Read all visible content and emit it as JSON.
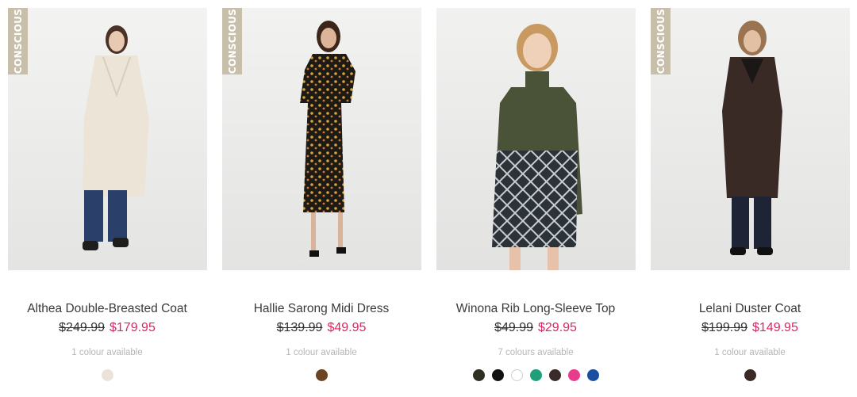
{
  "products": [
    {
      "badge": "CONSCIOUS",
      "name": "Althea Double-Breasted Coat",
      "was_price": "$249.99",
      "price": "$179.95",
      "colours": "1 colour available",
      "swatches": [
        "#ebe3da"
      ]
    },
    {
      "badge": "CONSCIOUS",
      "name": "Hallie Sarong Midi Dress",
      "was_price": "$139.99",
      "price": "$49.95",
      "colours": "1 colour available",
      "swatches": [
        "#6b4423"
      ]
    },
    {
      "badge": "",
      "name": "Winona Rib Long-Sleeve Top",
      "was_price": "$49.99",
      "price": "$29.95",
      "colours": "7 colours available",
      "swatches": [
        "#2e2e23",
        "#111111",
        "#ffffff",
        "#1f9f7a",
        "#3a2a2a",
        "#e83c8d",
        "#1a4fa0"
      ]
    },
    {
      "badge": "CONSCIOUS",
      "name": "Lelani Duster Coat",
      "was_price": "$199.99",
      "price": "$149.95",
      "colours": "1 colour available",
      "swatches": [
        "#3a2a26"
      ]
    }
  ],
  "colors": {
    "sale_price": "#e0245e",
    "badge_bg": "#c8bfab",
    "muted_text": "#b5b5b5"
  }
}
